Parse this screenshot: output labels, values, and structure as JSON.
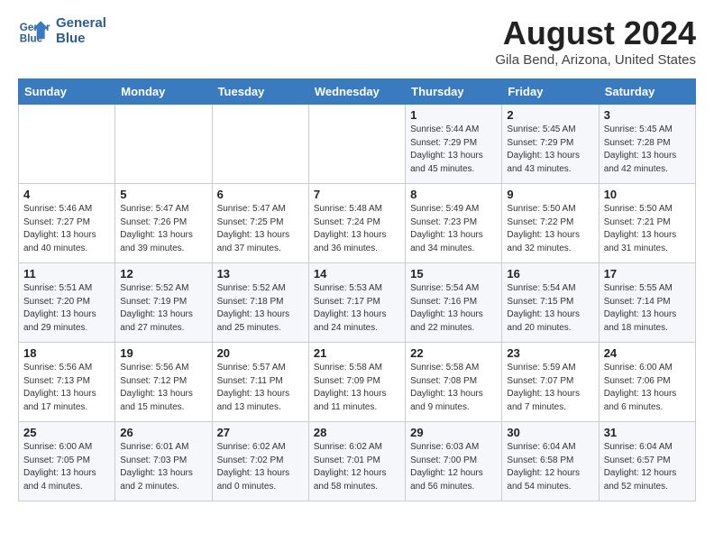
{
  "header": {
    "logo_line1": "General",
    "logo_line2": "Blue",
    "month": "August 2024",
    "location": "Gila Bend, Arizona, United States"
  },
  "weekdays": [
    "Sunday",
    "Monday",
    "Tuesday",
    "Wednesday",
    "Thursday",
    "Friday",
    "Saturday"
  ],
  "weeks": [
    [
      {
        "day": "",
        "info": ""
      },
      {
        "day": "",
        "info": ""
      },
      {
        "day": "",
        "info": ""
      },
      {
        "day": "",
        "info": ""
      },
      {
        "day": "1",
        "info": "Sunrise: 5:44 AM\nSunset: 7:29 PM\nDaylight: 13 hours\nand 45 minutes."
      },
      {
        "day": "2",
        "info": "Sunrise: 5:45 AM\nSunset: 7:29 PM\nDaylight: 13 hours\nand 43 minutes."
      },
      {
        "day": "3",
        "info": "Sunrise: 5:45 AM\nSunset: 7:28 PM\nDaylight: 13 hours\nand 42 minutes."
      }
    ],
    [
      {
        "day": "4",
        "info": "Sunrise: 5:46 AM\nSunset: 7:27 PM\nDaylight: 13 hours\nand 40 minutes."
      },
      {
        "day": "5",
        "info": "Sunrise: 5:47 AM\nSunset: 7:26 PM\nDaylight: 13 hours\nand 39 minutes."
      },
      {
        "day": "6",
        "info": "Sunrise: 5:47 AM\nSunset: 7:25 PM\nDaylight: 13 hours\nand 37 minutes."
      },
      {
        "day": "7",
        "info": "Sunrise: 5:48 AM\nSunset: 7:24 PM\nDaylight: 13 hours\nand 36 minutes."
      },
      {
        "day": "8",
        "info": "Sunrise: 5:49 AM\nSunset: 7:23 PM\nDaylight: 13 hours\nand 34 minutes."
      },
      {
        "day": "9",
        "info": "Sunrise: 5:50 AM\nSunset: 7:22 PM\nDaylight: 13 hours\nand 32 minutes."
      },
      {
        "day": "10",
        "info": "Sunrise: 5:50 AM\nSunset: 7:21 PM\nDaylight: 13 hours\nand 31 minutes."
      }
    ],
    [
      {
        "day": "11",
        "info": "Sunrise: 5:51 AM\nSunset: 7:20 PM\nDaylight: 13 hours\nand 29 minutes."
      },
      {
        "day": "12",
        "info": "Sunrise: 5:52 AM\nSunset: 7:19 PM\nDaylight: 13 hours\nand 27 minutes."
      },
      {
        "day": "13",
        "info": "Sunrise: 5:52 AM\nSunset: 7:18 PM\nDaylight: 13 hours\nand 25 minutes."
      },
      {
        "day": "14",
        "info": "Sunrise: 5:53 AM\nSunset: 7:17 PM\nDaylight: 13 hours\nand 24 minutes."
      },
      {
        "day": "15",
        "info": "Sunrise: 5:54 AM\nSunset: 7:16 PM\nDaylight: 13 hours\nand 22 minutes."
      },
      {
        "day": "16",
        "info": "Sunrise: 5:54 AM\nSunset: 7:15 PM\nDaylight: 13 hours\nand 20 minutes."
      },
      {
        "day": "17",
        "info": "Sunrise: 5:55 AM\nSunset: 7:14 PM\nDaylight: 13 hours\nand 18 minutes."
      }
    ],
    [
      {
        "day": "18",
        "info": "Sunrise: 5:56 AM\nSunset: 7:13 PM\nDaylight: 13 hours\nand 17 minutes."
      },
      {
        "day": "19",
        "info": "Sunrise: 5:56 AM\nSunset: 7:12 PM\nDaylight: 13 hours\nand 15 minutes."
      },
      {
        "day": "20",
        "info": "Sunrise: 5:57 AM\nSunset: 7:11 PM\nDaylight: 13 hours\nand 13 minutes."
      },
      {
        "day": "21",
        "info": "Sunrise: 5:58 AM\nSunset: 7:09 PM\nDaylight: 13 hours\nand 11 minutes."
      },
      {
        "day": "22",
        "info": "Sunrise: 5:58 AM\nSunset: 7:08 PM\nDaylight: 13 hours\nand 9 minutes."
      },
      {
        "day": "23",
        "info": "Sunrise: 5:59 AM\nSunset: 7:07 PM\nDaylight: 13 hours\nand 7 minutes."
      },
      {
        "day": "24",
        "info": "Sunrise: 6:00 AM\nSunset: 7:06 PM\nDaylight: 13 hours\nand 6 minutes."
      }
    ],
    [
      {
        "day": "25",
        "info": "Sunrise: 6:00 AM\nSunset: 7:05 PM\nDaylight: 13 hours\nand 4 minutes."
      },
      {
        "day": "26",
        "info": "Sunrise: 6:01 AM\nSunset: 7:03 PM\nDaylight: 13 hours\nand 2 minutes."
      },
      {
        "day": "27",
        "info": "Sunrise: 6:02 AM\nSunset: 7:02 PM\nDaylight: 13 hours\nand 0 minutes."
      },
      {
        "day": "28",
        "info": "Sunrise: 6:02 AM\nSunset: 7:01 PM\nDaylight: 12 hours\nand 58 minutes."
      },
      {
        "day": "29",
        "info": "Sunrise: 6:03 AM\nSunset: 7:00 PM\nDaylight: 12 hours\nand 56 minutes."
      },
      {
        "day": "30",
        "info": "Sunrise: 6:04 AM\nSunset: 6:58 PM\nDaylight: 12 hours\nand 54 minutes."
      },
      {
        "day": "31",
        "info": "Sunrise: 6:04 AM\nSunset: 6:57 PM\nDaylight: 12 hours\nand 52 minutes."
      }
    ]
  ]
}
